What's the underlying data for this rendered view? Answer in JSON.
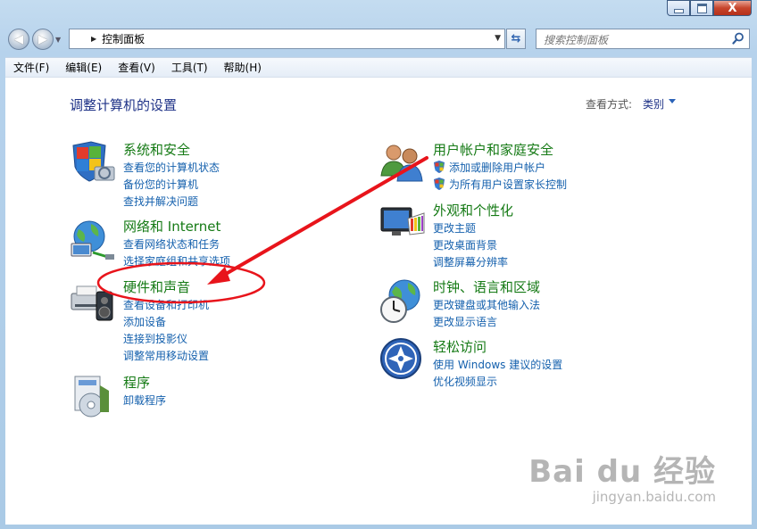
{
  "window": {
    "minimize_label": "",
    "maximize_label": "",
    "close_label": "X"
  },
  "nav": {
    "back": "◀",
    "forward": "▶",
    "address_segment": "控制面板",
    "search_placeholder": "搜索控制面板"
  },
  "menu": [
    "文件(F)",
    "编辑(E)",
    "查看(V)",
    "工具(T)",
    "帮助(H)"
  ],
  "page": {
    "title": "调整计算机的设置",
    "view_by_label": "查看方式:",
    "view_by_value": "类别"
  },
  "categories": {
    "system_security": {
      "title": "系统和安全",
      "icon": "system-security-icon",
      "links": [
        "查看您的计算机状态",
        "备份您的计算机",
        "查找并解决问题"
      ]
    },
    "network": {
      "title": "网络和 Internet",
      "icon": "network-icon",
      "links": [
        "查看网络状态和任务",
        "选择家庭组和共享选项"
      ]
    },
    "hardware": {
      "title": "硬件和声音",
      "icon": "hardware-sound-icon",
      "links": [
        "查看设备和打印机",
        "添加设备",
        "连接到投影仪",
        "调整常用移动设置"
      ]
    },
    "programs": {
      "title": "程序",
      "icon": "programs-icon",
      "links": [
        "卸载程序"
      ]
    },
    "user_accounts": {
      "title": "用户帐户和家庭安全",
      "icon": "user-accounts-icon",
      "links": [
        "添加或删除用户帐户",
        "为所有用户设置家长控制"
      ]
    },
    "appearance": {
      "title": "外观和个性化",
      "icon": "appearance-icon",
      "links": [
        "更改主题",
        "更改桌面背景",
        "调整屏幕分辨率"
      ]
    },
    "clock": {
      "title": "时钟、语言和区域",
      "icon": "clock-region-icon",
      "links": [
        "更改键盘或其他输入法",
        "更改显示语言"
      ]
    },
    "ease": {
      "title": "轻松访问",
      "icon": "ease-of-access-icon",
      "links": [
        "使用 Windows 建议的设置",
        "优化视频显示"
      ]
    }
  },
  "colors": {
    "category_title": "#157a15",
    "link": "#1460ad",
    "annotation": "#e8141b"
  },
  "watermark": {
    "brand": "Bai du 经验",
    "url": "jingyan.baidu.com"
  }
}
